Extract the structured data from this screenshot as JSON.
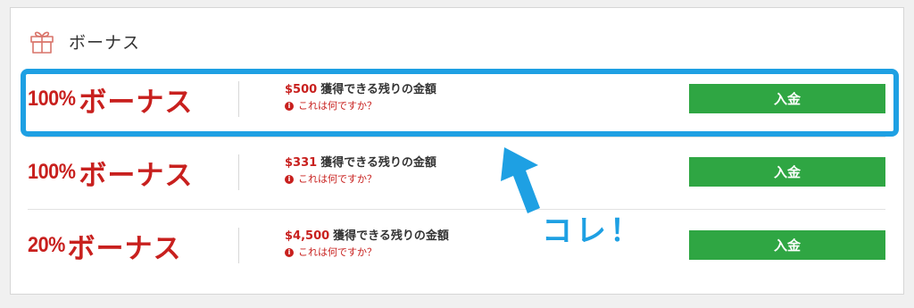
{
  "header": {
    "title": "ボーナス",
    "icon": "gift-icon"
  },
  "bonuses": [
    {
      "percent": "100%",
      "label": "ボーナス",
      "amount": "$500",
      "amount_desc": "獲得できる残りの金額",
      "help_text": "これは何ですか？",
      "button_label": "入金"
    },
    {
      "percent": "100%",
      "label": "ボーナス",
      "amount": "$331",
      "amount_desc": "獲得できる残りの金額",
      "help_text": "これは何ですか？",
      "button_label": "入金"
    },
    {
      "percent": "20%",
      "label": "ボーナス",
      "amount": "$4,500",
      "amount_desc": "獲得できる残りの金額",
      "help_text": "これは何ですか？",
      "button_label": "入金"
    }
  ],
  "annotation": {
    "callout_text": "コレ！"
  },
  "colors": {
    "accent_red": "#c8201e",
    "button_green": "#2fa643",
    "annotation_blue": "#1ea0e3"
  }
}
